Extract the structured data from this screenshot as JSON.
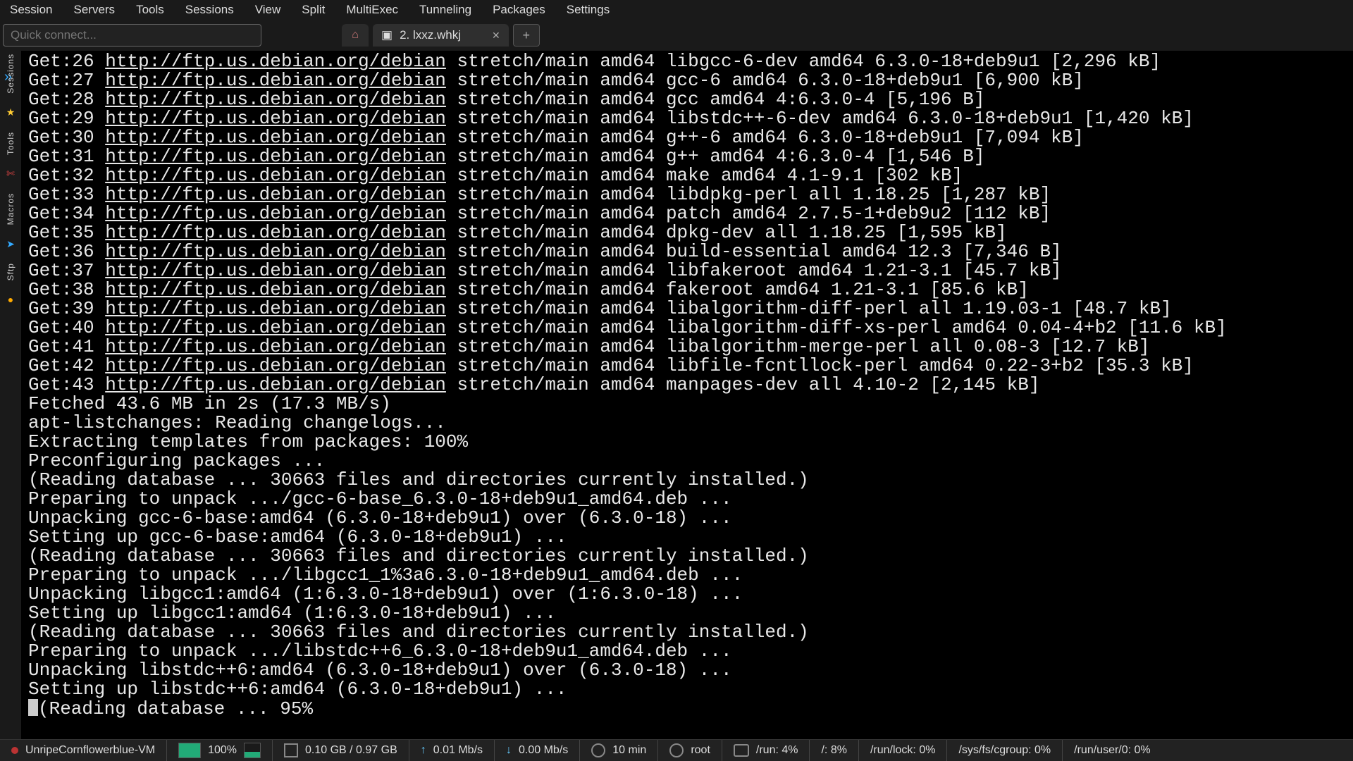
{
  "menubar": [
    "Session",
    "Servers",
    "Tools",
    "Sessions",
    "View",
    "Split",
    "MultiExec",
    "Tunneling",
    "Packages",
    "Settings"
  ],
  "quick_connect_placeholder": "Quick connect...",
  "tabs": {
    "active_label": "2. lxxz.whkj"
  },
  "sidebar_labels": [
    "Sessions",
    "Tools",
    "Macros",
    "Sftp"
  ],
  "apt_url": "http://ftp.us.debian.org/debian",
  "get_lines": [
    "Get:26 __URL__ stretch/main amd64 libgcc-6-dev amd64 6.3.0-18+deb9u1 [2,296 kB]",
    "Get:27 __URL__ stretch/main amd64 gcc-6 amd64 6.3.0-18+deb9u1 [6,900 kB]",
    "Get:28 __URL__ stretch/main amd64 gcc amd64 4:6.3.0-4 [5,196 B]",
    "Get:29 __URL__ stretch/main amd64 libstdc++-6-dev amd64 6.3.0-18+deb9u1 [1,420 kB]",
    "Get:30 __URL__ stretch/main amd64 g++-6 amd64 6.3.0-18+deb9u1 [7,094 kB]",
    "Get:31 __URL__ stretch/main amd64 g++ amd64 4:6.3.0-4 [1,546 B]",
    "Get:32 __URL__ stretch/main amd64 make amd64 4.1-9.1 [302 kB]",
    "Get:33 __URL__ stretch/main amd64 libdpkg-perl all 1.18.25 [1,287 kB]",
    "Get:34 __URL__ stretch/main amd64 patch amd64 2.7.5-1+deb9u2 [112 kB]",
    "Get:35 __URL__ stretch/main amd64 dpkg-dev all 1.18.25 [1,595 kB]",
    "Get:36 __URL__ stretch/main amd64 build-essential amd64 12.3 [7,346 B]",
    "Get:37 __URL__ stretch/main amd64 libfakeroot amd64 1.21-3.1 [45.7 kB]",
    "Get:38 __URL__ stretch/main amd64 fakeroot amd64 1.21-3.1 [85.6 kB]",
    "Get:39 __URL__ stretch/main amd64 libalgorithm-diff-perl all 1.19.03-1 [48.7 kB]",
    "Get:40 __URL__ stretch/main amd64 libalgorithm-diff-xs-perl amd64 0.04-4+b2 [11.6 kB]",
    "Get:41 __URL__ stretch/main amd64 libalgorithm-merge-perl all 0.08-3 [12.7 kB]",
    "Get:42 __URL__ stretch/main amd64 libfile-fcntllock-perl amd64 0.22-3+b2 [35.3 kB]",
    "Get:43 __URL__ stretch/main amd64 manpages-dev all 4.10-2 [2,145 kB]"
  ],
  "plain_lines": [
    "Fetched 43.6 MB in 2s (17.3 MB/s)",
    "apt-listchanges: Reading changelogs...",
    "Extracting templates from packages: 100%",
    "Preconfiguring packages ...",
    "(Reading database ... 30663 files and directories currently installed.)",
    "Preparing to unpack .../gcc-6-base_6.3.0-18+deb9u1_amd64.deb ...",
    "Unpacking gcc-6-base:amd64 (6.3.0-18+deb9u1) over (6.3.0-18) ...",
    "Setting up gcc-6-base:amd64 (6.3.0-18+deb9u1) ...",
    "(Reading database ... 30663 files and directories currently installed.)",
    "Preparing to unpack .../libgcc1_1%3a6.3.0-18+deb9u1_amd64.deb ...",
    "Unpacking libgcc1:amd64 (1:6.3.0-18+deb9u1) over (1:6.3.0-18) ...",
    "Setting up libgcc1:amd64 (1:6.3.0-18+deb9u1) ...",
    "(Reading database ... 30663 files and directories currently installed.)",
    "Preparing to unpack .../libstdc++6_6.3.0-18+deb9u1_amd64.deb ...",
    "Unpacking libstdc++6:amd64 (6.3.0-18+deb9u1) over (6.3.0-18) ...",
    "Setting up libstdc++6:amd64 (6.3.0-18+deb9u1) ..."
  ],
  "last_line_prefix": "(Reading database ... 95%",
  "status": {
    "host": "UnripeCornflowerblue-VM",
    "cpu": "100%",
    "mem": "0.10 GB / 0.97 GB",
    "net_up": "0.01 Mb/s",
    "net_dn": "0.00 Mb/s",
    "uptime": "10 min",
    "user": "root",
    "run": "/run: 4%",
    "root_fs": "/: 8%",
    "run_lock": "/run/lock: 0%",
    "cgroup": "/sys/fs/cgroup: 0%",
    "run_user": "/run/user/0: 0%"
  }
}
